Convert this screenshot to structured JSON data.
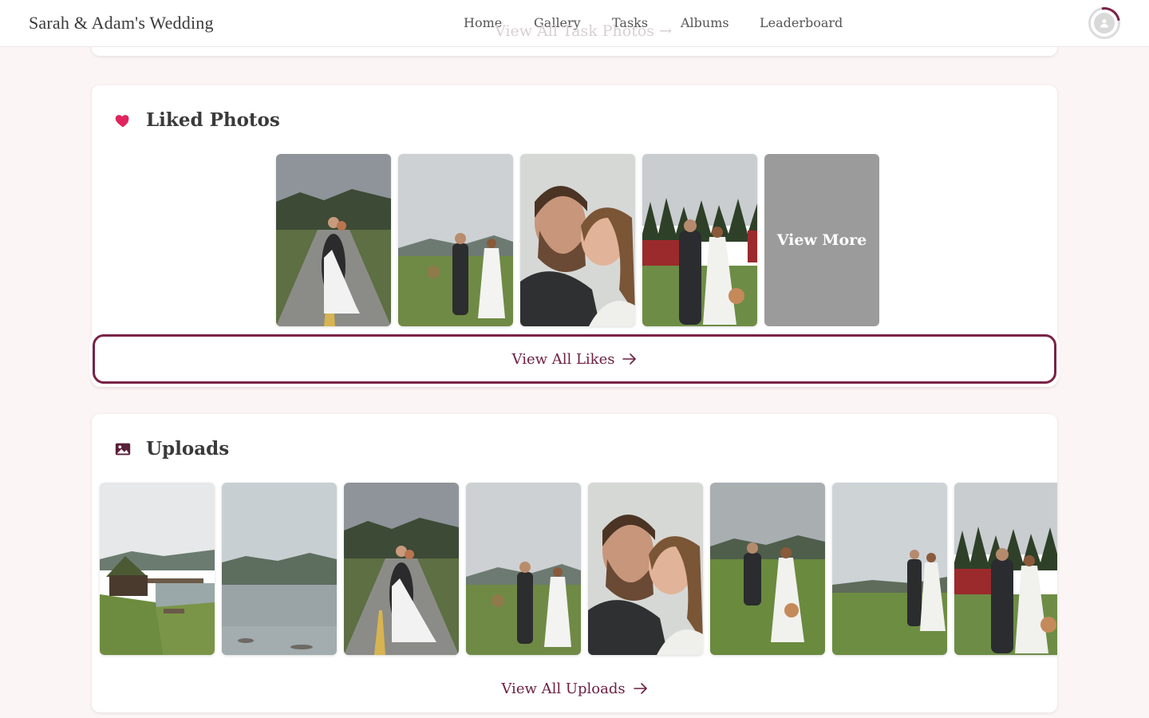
{
  "header": {
    "brand": "Sarah & Adam's Wedding",
    "nav": [
      "Home",
      "Gallery",
      "Tasks",
      "Albums",
      "Leaderboard"
    ],
    "ghost_link": "View All Task Photos →",
    "avatar_icon": "user-avatar-icon"
  },
  "liked": {
    "title": "Liked Photos",
    "icon": "heart-icon",
    "icon_color": "#e0245e",
    "view_more": "View More",
    "view_all": "View All Likes"
  },
  "uploads": {
    "title": "Uploads",
    "icon": "image-icon",
    "view_all": "View All Uploads"
  },
  "colors": {
    "accent": "#7a2347",
    "page_background": "#fcf5f6"
  }
}
